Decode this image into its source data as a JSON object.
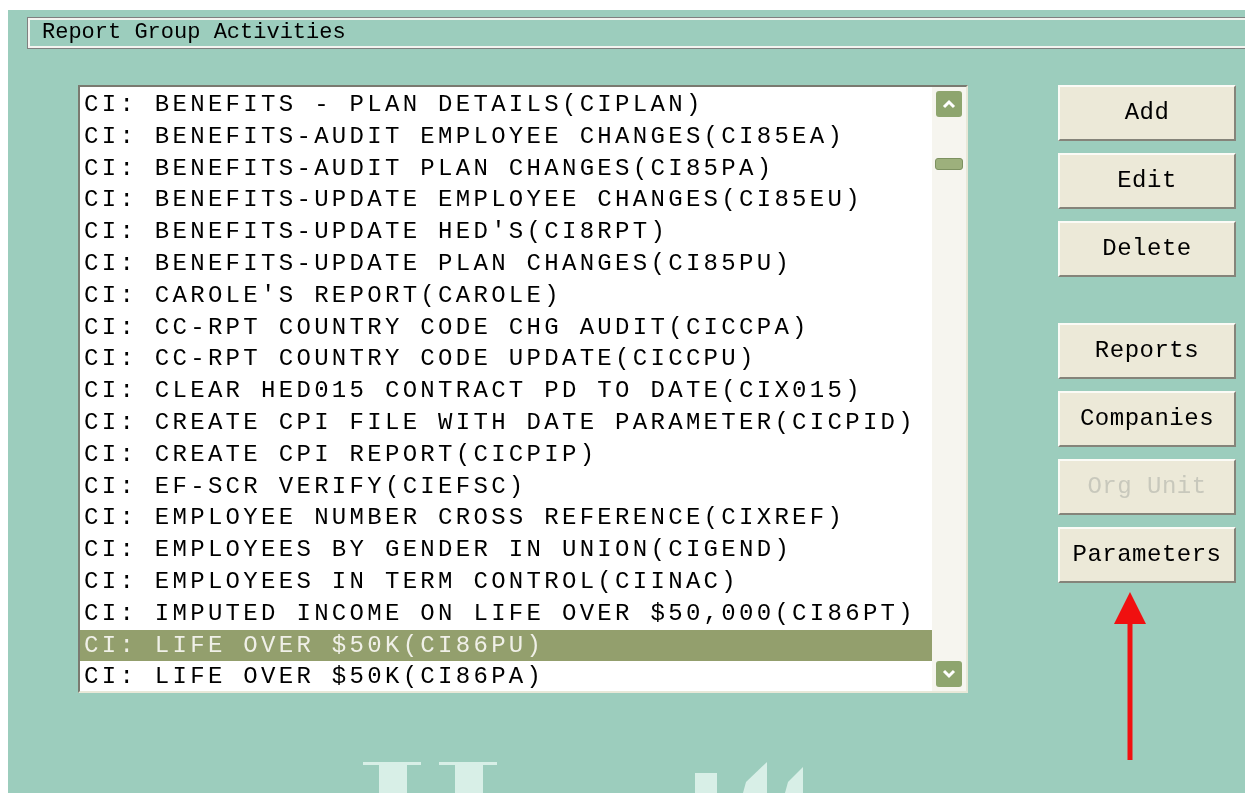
{
  "window": {
    "title": "Report Group Activities"
  },
  "list": {
    "items": [
      {
        "label": "CI: BENEFITS - PLAN DETAILS(CIPLAN)",
        "selected": false
      },
      {
        "label": "CI: BENEFITS-AUDIT EMPLOYEE CHANGES(CI85EA)",
        "selected": false
      },
      {
        "label": "CI: BENEFITS-AUDIT PLAN CHANGES(CI85PA)",
        "selected": false
      },
      {
        "label": "CI: BENEFITS-UPDATE EMPLOYEE CHANGES(CI85EU)",
        "selected": false
      },
      {
        "label": "CI: BENEFITS-UPDATE HED'S(CI8RPT)",
        "selected": false
      },
      {
        "label": "CI: BENEFITS-UPDATE PLAN CHANGES(CI85PU)",
        "selected": false
      },
      {
        "label": "CI: CAROLE'S REPORT(CAROLE)",
        "selected": false
      },
      {
        "label": "CI: CC-RPT COUNTRY CODE CHG AUDIT(CICCPA)",
        "selected": false
      },
      {
        "label": "CI: CC-RPT COUNTRY CODE UPDATE(CICCPU)",
        "selected": false
      },
      {
        "label": "CI: CLEAR HED015 CONTRACT PD TO DATE(CIX015)",
        "selected": false
      },
      {
        "label": "CI: CREATE CPI FILE WITH DATE PARAMETER(CICPID)",
        "selected": false
      },
      {
        "label": "CI: CREATE CPI REPORT(CICPIP)",
        "selected": false
      },
      {
        "label": "CI: EF-SCR VERIFY(CIEFSC)",
        "selected": false
      },
      {
        "label": "CI: EMPLOYEE NUMBER CROSS REFERENCE(CIXREF)",
        "selected": false
      },
      {
        "label": "CI: EMPLOYEES BY GENDER IN UNION(CIGEND)",
        "selected": false
      },
      {
        "label": "CI: EMPLOYEES IN TERM CONTROL(CIINAC)",
        "selected": false
      },
      {
        "label": "CI: IMPUTED INCOME ON LIFE OVER $50,000(CI86PT)",
        "selected": false
      },
      {
        "label": "CI: LIFE OVER $50K(CI86PU)",
        "selected": true
      },
      {
        "label": "CI: LIFE OVER $50K(CI86PA)",
        "selected": false
      }
    ]
  },
  "button_groups": [
    [
      {
        "label": "Add",
        "disabled": false
      },
      {
        "label": "Edit",
        "disabled": false
      },
      {
        "label": "Delete",
        "disabled": false
      }
    ],
    [
      {
        "label": "Reports",
        "disabled": false
      },
      {
        "label": "Companies",
        "disabled": false
      },
      {
        "label": "Org Unit",
        "disabled": true
      },
      {
        "label": "Parameters",
        "disabled": false
      }
    ]
  ]
}
